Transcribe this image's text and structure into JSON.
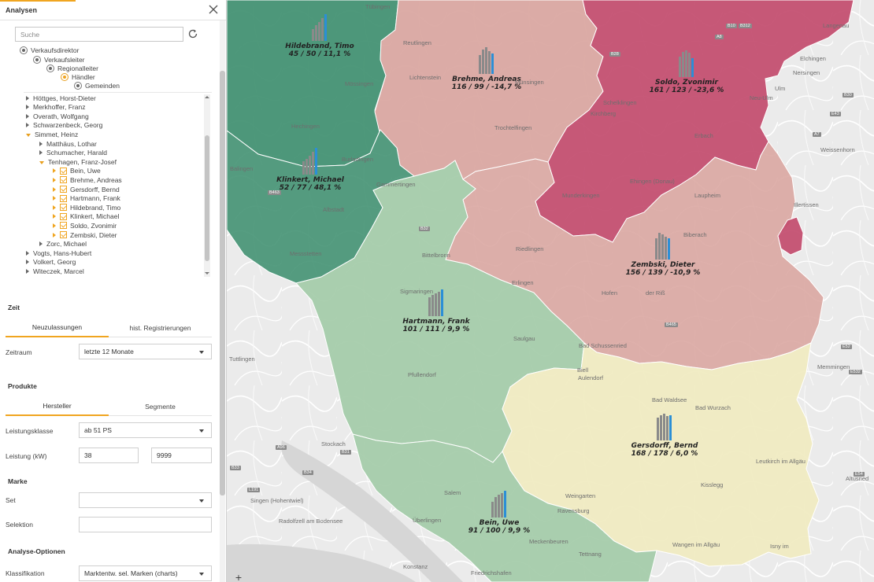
{
  "panel": {
    "title": "Analysen",
    "search_placeholder": "Suche",
    "hierarchy": [
      {
        "label": "Verkaufsdirektor",
        "active": false
      },
      {
        "label": "Verkaufsleiter",
        "active": false
      },
      {
        "label": "Regionalleiter",
        "active": false
      },
      {
        "label": "Händler",
        "active": true
      },
      {
        "label": "Gemeinden",
        "active": false
      }
    ],
    "tree": [
      {
        "label": "Höttges, Horst-Dieter",
        "level": 0,
        "state": "closed"
      },
      {
        "label": "Merkhoffer, Franz",
        "level": 0,
        "state": "closed"
      },
      {
        "label": "Overath, Wolfgang",
        "level": 0,
        "state": "closed"
      },
      {
        "label": "Schwarzenbeck, Georg",
        "level": 0,
        "state": "closed"
      },
      {
        "label": "Simmet, Heinz",
        "level": 0,
        "state": "open"
      },
      {
        "label": "Matthäus, Lothar",
        "level": 1,
        "state": "closed"
      },
      {
        "label": "Schumacher, Harald",
        "level": 1,
        "state": "closed"
      },
      {
        "label": "Tenhagen, Franz-Josef",
        "level": 1,
        "state": "open"
      },
      {
        "label": "Bein, Uwe",
        "level": 2,
        "state": "checked"
      },
      {
        "label": "Brehme, Andreas",
        "level": 2,
        "state": "checked"
      },
      {
        "label": "Gersdorff, Bernd",
        "level": 2,
        "state": "checked"
      },
      {
        "label": "Hartmann, Frank",
        "level": 2,
        "state": "checked"
      },
      {
        "label": "Hildebrand, Timo",
        "level": 2,
        "state": "checked"
      },
      {
        "label": "Klinkert, Michael",
        "level": 2,
        "state": "checked"
      },
      {
        "label": "Soldo, Zvonimir",
        "level": 2,
        "state": "checked"
      },
      {
        "label": "Zembski, Dieter",
        "level": 2,
        "state": "checked"
      },
      {
        "label": "Zorc, Michael",
        "level": 1,
        "state": "closed"
      },
      {
        "label": "Vogts, Hans-Hubert",
        "level": 0,
        "state": "closed"
      },
      {
        "label": "Volkert, Georg",
        "level": 0,
        "state": "closed"
      },
      {
        "label": "Witeczek, Marcel",
        "level": 0,
        "state": "closed"
      }
    ],
    "zeit": {
      "heading": "Zeit",
      "tabs": [
        "Neuzulassungen",
        "hist. Registrierungen"
      ],
      "zeitraum_label": "Zeitraum",
      "zeitraum_value": "letzte 12 Monate"
    },
    "produkte": {
      "heading": "Produkte",
      "tabs": [
        "Hersteller",
        "Segmente"
      ],
      "leistungsklasse_label": "Leistungsklasse",
      "leistungsklasse_value": "ab 51 PS",
      "leistung_label": "Leistung (kW)",
      "leistung_min": "38",
      "leistung_max": "9999"
    },
    "marke": {
      "heading": "Marke",
      "set_label": "Set",
      "set_value": "",
      "selektion_label": "Selektion",
      "selektion_value": ""
    },
    "analyse": {
      "heading": "Analyse-Optionen",
      "klassifikation_label": "Klassifikation",
      "klassifikation_value": "Marktentw. sel. Marken (charts)"
    }
  },
  "map": {
    "zoom_in_label": "+",
    "colors": {
      "dark_green": "#3f8f70",
      "light_green": "#a3cba8",
      "pink": "#d9a59f",
      "dark_pink": "#c24b6c",
      "yellow": "#f0ebc2",
      "bar_grey": "#8a8a8a",
      "bar_blue": "#2b8fd6"
    },
    "regions": [
      {
        "name": "Hildebrand, Timo",
        "stats": "45 / 50 / 11,1 %",
        "bars": [
          0.45,
          0.6,
          0.7,
          0.85,
          1.0
        ]
      },
      {
        "name": "Brehme, Andreas",
        "stats": "116 / 99 / -14,7 %",
        "bars": [
          0.7,
          0.9,
          1.0,
          0.85,
          0.75
        ]
      },
      {
        "name": "Soldo, Zvonimir",
        "stats": "161 / 123 / -23,6 %",
        "bars": [
          0.75,
          0.95,
          1.0,
          0.9,
          0.7
        ]
      },
      {
        "name": "Klinkert, Michael",
        "stats": "52 / 77 / 48,1 %",
        "bars": [
          0.5,
          0.6,
          0.7,
          0.85,
          1.0
        ]
      },
      {
        "name": "Zembski, Dieter",
        "stats": "156 / 139 / -10,9 %",
        "bars": [
          0.8,
          1.0,
          0.95,
          0.85,
          0.8
        ]
      },
      {
        "name": "Hartmann, Frank",
        "stats": "101 / 111 / 9,9 %",
        "bars": [
          0.7,
          0.8,
          0.85,
          0.9,
          1.0
        ]
      },
      {
        "name": "Gersdorff, Bernd",
        "stats": "168 / 178 / 6,0 %",
        "bars": [
          0.85,
          0.95,
          1.0,
          0.9,
          0.95
        ]
      },
      {
        "name": "Bein, Uwe",
        "stats": "91 / 100 / 9,9 %",
        "bars": [
          0.6,
          0.75,
          0.85,
          0.9,
          1.0
        ]
      }
    ],
    "towns": [
      "Tübingen",
      "Reutlingen",
      "Mössingen",
      "Hechingen",
      "Münsingen",
      "Schelklingen",
      "Erbach",
      "Ehingen (Donau)",
      "Ulm",
      "Neu-Ulm",
      "Balingen",
      "Burladingen",
      "Albstadt",
      "Messstetten",
      "Gammertingen",
      "Laupheim",
      "Munderkingen",
      "Riedlingen",
      "Sigmaringen",
      "Saulgau",
      "Erlingen",
      "der Riß",
      "Tuttlingen",
      "Bad Schussenried",
      "Aulendorf",
      "Bad Waldsee",
      "Bad Wurzach",
      "Pfullendorf",
      "Stockach",
      "Weingarten",
      "Ravensburg",
      "Leutkirch im Allgäu",
      "Singen (Hohentwiel)",
      "Radolfzell am Bodensee",
      "Salem",
      "Überlingen",
      "Meckenbeuren",
      "Tettnang",
      "Konstanz",
      "Friedrichshafen",
      "Wangen im Allgäu",
      "Memmingen",
      "Weissenhorn",
      "Nersingen",
      "Elchingen",
      "Langenau",
      "Illertissen",
      "Altusried",
      "Isny im",
      "Kisslegg",
      "Kirchberg",
      "Biberach",
      "Hofen",
      "Lichtenstein",
      "Biell",
      "Bittelbronn",
      "Trochtelfingen"
    ],
    "roads": [
      "A8",
      "A7",
      "B28",
      "B30",
      "A96",
      "B31",
      "B33",
      "B34",
      "B463",
      "B465",
      "B32",
      "B312",
      "E43",
      "E52",
      "E532",
      "E54",
      "L191",
      "B10"
    ]
  }
}
